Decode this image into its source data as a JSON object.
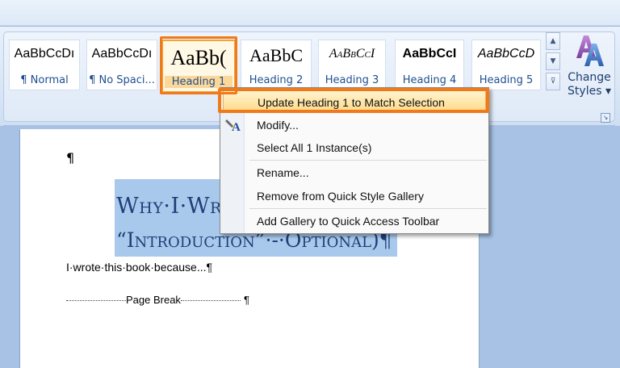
{
  "ribbon": {
    "styles": [
      {
        "sample": "AaBbCcDı",
        "name": "¶ Normal"
      },
      {
        "sample": "AaBbCcDı",
        "name": "¶ No Spaci..."
      },
      {
        "sample": "AaBb(",
        "name": "Heading 1"
      },
      {
        "sample": "AaBbC",
        "name": "Heading 2"
      },
      {
        "sample": "AaBbCcI",
        "name": "Heading 3"
      },
      {
        "sample": "AaBbCcI",
        "name": "Heading 4"
      },
      {
        "sample": "AaBbCcD",
        "name": "Heading 5"
      }
    ],
    "change_styles_line1": "Change",
    "change_styles_line2": "Styles ▾",
    "scroll_up_icon": "▲",
    "scroll_down_icon": "▼",
    "more_icon": "⊽",
    "launcher_icon": "↘"
  },
  "document": {
    "pilcrow": "¶",
    "heading_line1": "Why·I·Wro",
    "heading_line2": "“Introduction”·-·Optional)¶",
    "body_line": "I·wrote·this·book·because...¶",
    "page_break_label": "Page Break",
    "page_break_end": "¶"
  },
  "context_menu": {
    "items": [
      {
        "label": "Update Heading 1 to Match Selection"
      },
      {
        "label": "Modify..."
      },
      {
        "label": "Select All 1 Instance(s)"
      },
      {
        "label": "Rename..."
      },
      {
        "label": "Remove from Quick Style Gallery"
      },
      {
        "label": "Add Gallery to Quick Access Toolbar"
      }
    ]
  },
  "colors": {
    "accent_annotation": "#f07a1a",
    "heading_text": "#1f3f78",
    "selection": "#a9c9ec",
    "menu_highlight": "#ffd988"
  }
}
